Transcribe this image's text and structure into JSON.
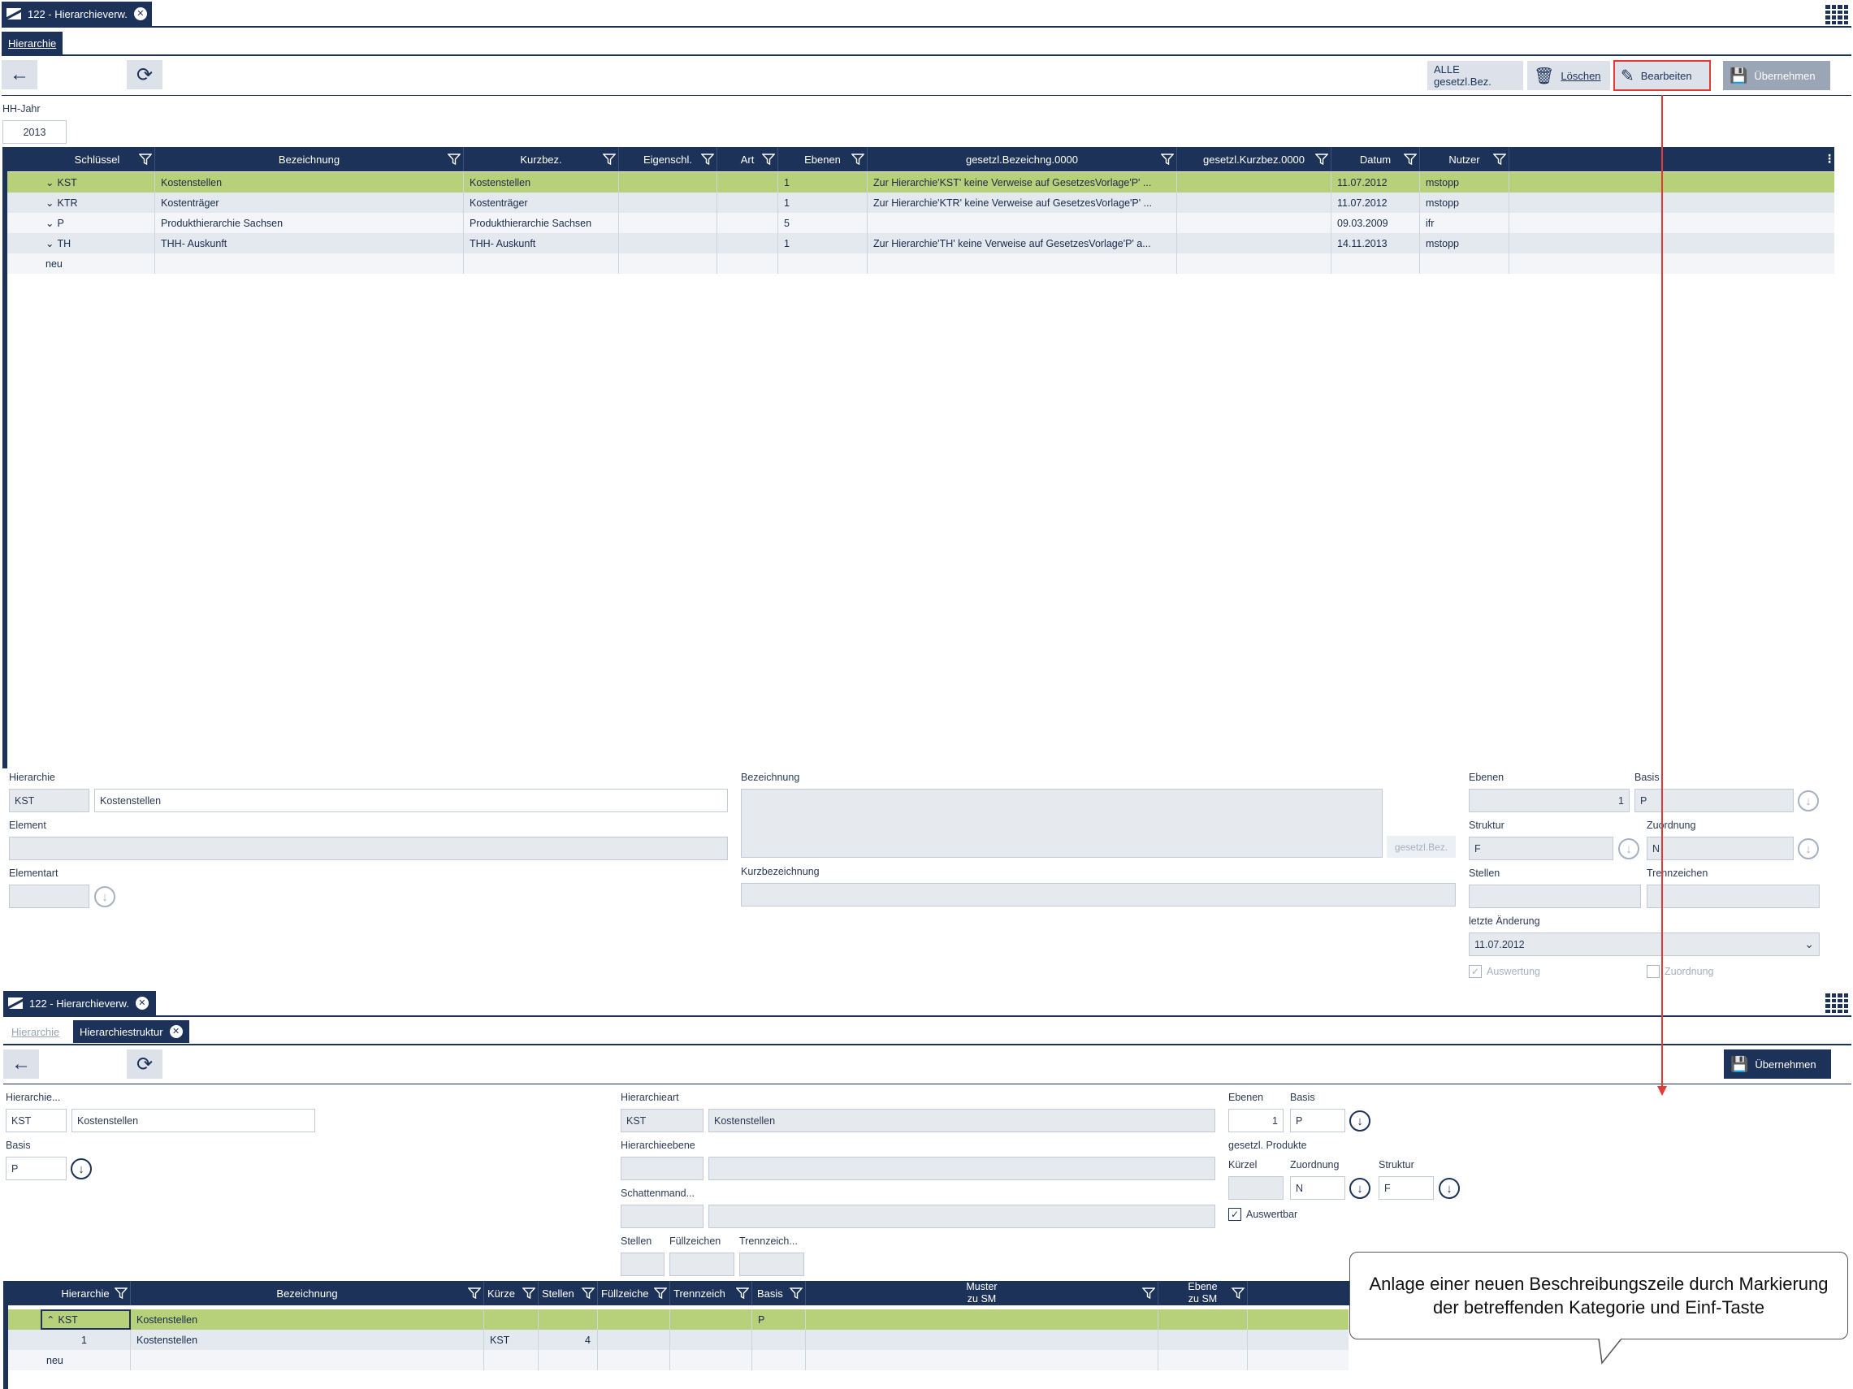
{
  "window": {
    "tab_title": "122 - Hierarchieverw."
  },
  "top": {
    "subtab": "Hierarchie",
    "toolbar": {
      "all_btn": "ALLE gesetzl.Bez.",
      "delete_btn": "Löschen",
      "edit_btn": "Bearbeiten",
      "apply_btn": "Übernehmen"
    },
    "hhjahr_label": "HH-Jahr",
    "hhjahr_value": "2013",
    "table": {
      "columns": [
        "Schlüssel",
        "Bezeichnung",
        "Kurzbez.",
        "Eigenschl.",
        "Art",
        "Ebenen",
        "gesetzl.Bezeichng.0000",
        "gesetzl.Kurzbez.0000",
        "Datum",
        "Nutzer"
      ],
      "rows": [
        [
          "KST",
          "Kostenstellen",
          "Kostenstellen",
          "",
          "",
          "1",
          "Zur Hierarchie'KST' keine Verweise auf GesetzesVorlage'P' ...",
          "",
          "11.07.2012",
          "mstopp"
        ],
        [
          "KTR",
          "Kostenträger",
          "Kostenträger",
          "",
          "",
          "1",
          "Zur Hierarchie'KTR' keine Verweise auf GesetzesVorlage'P' ...",
          "",
          "11.07.2012",
          "mstopp"
        ],
        [
          "P",
          "Produkthierarchie Sachsen",
          "Produkthierarchie Sachsen",
          "",
          "",
          "5",
          "",
          "",
          "09.03.2009",
          "ifr"
        ],
        [
          "TH",
          "THH- Auskunft",
          "THH- Auskunft",
          "",
          "",
          "1",
          "Zur Hierarchie'TH' keine Verweise auf GesetzesVorlage'P' a...",
          "",
          "14.11.2013",
          "mstopp"
        ]
      ],
      "new_row": "neu"
    },
    "form": {
      "hierarchie_label": "Hierarchie",
      "hierarchie_code": "KST",
      "hierarchie_name": "Kostenstellen",
      "element_label": "Element",
      "elementart_label": "Elementart",
      "bezeichnung_label": "Bezeichnung",
      "gesetzl_btn": "gesetzl.Bez.",
      "kurzbez_label": "Kurzbezeichnung",
      "ebenen_label": "Ebenen",
      "ebenen_value": "1",
      "basis_label": "Basis",
      "basis_value": "P",
      "struktur_label": "Struktur",
      "struktur_value": "F",
      "zuordnung_label": "Zuordnung",
      "zuordnung_value": "N",
      "stellen_label": "Stellen",
      "trennzeichen_label": "Trennzeichen",
      "letzte_label": "letzte Änderung",
      "letzte_value": "11.07.2012",
      "auswertung_label": "Auswertung",
      "zuordnung_chk_label": "Zuordnung"
    }
  },
  "bottom": {
    "subtab1": "Hierarchie",
    "subtab2": "Hierarchiestruktur",
    "apply_btn": "Übernehmen",
    "form": {
      "hier_label": "Hierarchie...",
      "hier_code": "KST",
      "hier_name": "Kostenstellen",
      "basis_label": "Basis",
      "basis_value": "P",
      "hierart_label": "Hierarchieart",
      "hierart_code": "KST",
      "hierart_name": "Kostenstellen",
      "hierebene_label": "Hierarchieebene",
      "schatten_label": "Schattenmand...",
      "stellen_label": "Stellen",
      "fuell_label": "Füllzeichen",
      "trenn_label": "Trennzeich...",
      "ebenen_label": "Ebenen",
      "ebenen_value": "1",
      "basis2_label": "Basis",
      "basis2_value": "P",
      "gesetzl_label": "gesetzl. Produkte",
      "kuerzel_label": "Kürzel",
      "zuordnung_label": "Zuordnung",
      "zuordnung_value": "N",
      "struktur_label": "Struktur",
      "struktur_value": "F",
      "auswertbar_label": "Auswertbar"
    },
    "table": {
      "columns": [
        "Hierarchie",
        "Bezeichnung",
        "Kürze",
        "Stellen",
        "Füllzeiche",
        "Trennzeich",
        "Basis",
        "Muster\nzu SM",
        "Ebene\nzu SM"
      ],
      "rows": [
        [
          "KST",
          "Kostenstellen",
          "",
          "",
          "",
          "",
          "P",
          "",
          ""
        ],
        [
          "1",
          "Kostenstellen",
          "KST",
          "4",
          "",
          "",
          "",
          "",
          ""
        ]
      ],
      "new_row": "neu"
    }
  },
  "callout": "Anlage einer neuen Beschreibungszeile durch Markierung der betreffenden Kategorie und Einf-Taste"
}
